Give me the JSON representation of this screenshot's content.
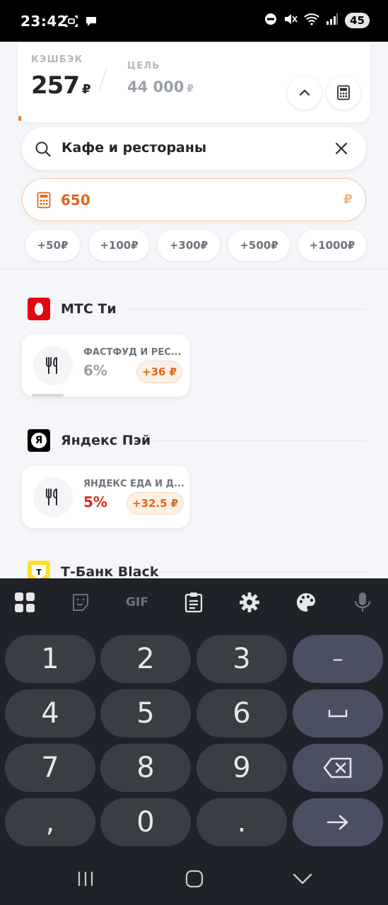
{
  "status_bar": {
    "time": "23:42",
    "battery": "45",
    "icons_left": [
      "screenshot-icon",
      "chat-bubble-icon"
    ],
    "icons_right": [
      "dnd-icon",
      "mute-icon",
      "wifi-icon",
      "signal-icon"
    ]
  },
  "summary": {
    "cashback_label": "КЭШБЭК",
    "cashback_value": "257",
    "cashback_currency": "₽",
    "goal_label": "ЦЕЛЬ",
    "goal_value": "44 000",
    "goal_currency": "₽",
    "collapse_icon": "chevron-up-icon",
    "calculator_icon": "calculator-icon"
  },
  "search": {
    "value": "Кафе и рестораны",
    "search_icon": "search-icon",
    "clear_icon": "close-icon"
  },
  "amount": {
    "value": "650",
    "currency": "₽",
    "icon": "calculator-icon"
  },
  "quick_amounts": [
    "+50₽",
    "+100₽",
    "+300₽",
    "+500₽",
    "+1000₽"
  ],
  "banks": [
    {
      "name": "МТС Ти",
      "logo_color": "#e30611",
      "offers": [
        {
          "title": "ФАСТФУД И РЕС...",
          "percent": "6%",
          "percent_color": "#9aa0a8",
          "bonus": "+36 ₽",
          "icon": "fork-knife-icon"
        }
      ]
    },
    {
      "name": "Яндекс Пэй",
      "logo_color": "#000000",
      "logo_letter": "Я",
      "offers": [
        {
          "title": "ЯНДЕКС ЕДА И Д...",
          "percent": "5%",
          "percent_color": "#e0281e",
          "bonus": "+32.5 ₽",
          "icon": "fork-knife-icon"
        }
      ]
    },
    {
      "name": "Т-Банк Black",
      "logo_color": "#ffdd2d",
      "logo_letter": "Т",
      "offers": []
    }
  ],
  "keyboard": {
    "toolbar": [
      "apps-icon",
      "sticker-icon",
      "GIF",
      "clipboard-icon",
      "settings-icon",
      "palette-icon",
      "microphone-icon"
    ],
    "keys": [
      "1",
      "2",
      "3",
      "–",
      "4",
      "5",
      "6",
      "␣",
      "7",
      "8",
      "9",
      "⌫",
      ",",
      "0",
      ".",
      "→"
    ]
  },
  "nav_bar": [
    "recents-icon",
    "home-icon",
    "back-icon"
  ]
}
